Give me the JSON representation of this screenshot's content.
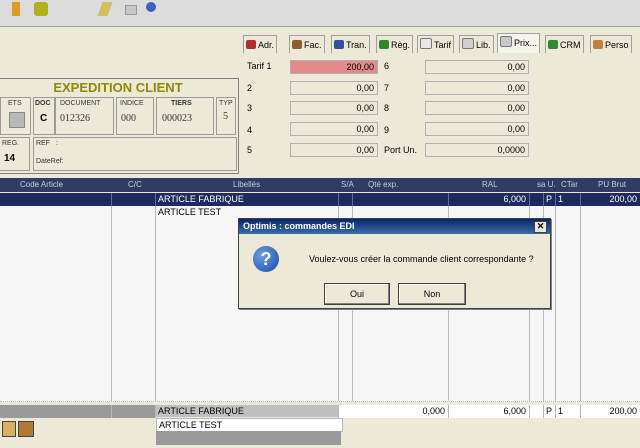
{
  "colors": {
    "tarif1_bg": "#e48a8a",
    "grid_head": "#313b66",
    "selected_row": "#1c2a5e",
    "title_olive": "#8b8b00"
  },
  "tabs": [
    {
      "label": "Adr.",
      "icon": "address-icon"
    },
    {
      "label": "Fac.",
      "icon": "invoice-icon"
    },
    {
      "label": "Tran.",
      "icon": "truck-icon"
    },
    {
      "label": "Règ.",
      "icon": "money-icon"
    },
    {
      "label": "Tarif",
      "icon": "tariff-icon"
    },
    {
      "label": "Lib.",
      "icon": "lib-icon"
    },
    {
      "label": "Prix...",
      "icon": "price-icon"
    },
    {
      "label": "CRM",
      "icon": "crm-icon"
    },
    {
      "label": "Perso",
      "icon": "person-icon"
    }
  ],
  "header": {
    "title": "EXPEDITION CLIENT",
    "ets_label": "ETS",
    "doc_label": "DOC",
    "doc_value": "C",
    "document_label": "DOCUMENT",
    "document_value": "012326",
    "indice_label": "INDICE",
    "indice_value": "000",
    "tiers_label": "TIERS",
    "tiers_value": "000023",
    "typ_label": "TYP",
    "typ_value": "5",
    "reg_label": "REG.",
    "reg_value": "14",
    "ref_label": "REF",
    "ref_value": ":",
    "dateref_label": "DateRef:"
  },
  "tarifs": {
    "t1_label": "Tarif 1",
    "t1_value": "200,00",
    "t2_label": "2",
    "t2_value": "0,00",
    "t3_label": "3",
    "t3_value": "0,00",
    "t4_label": "4",
    "t4_value": "0,00",
    "t5_label": "5",
    "t5_value": "0,00",
    "t6_label": "6",
    "t6_value": "0,00",
    "t7_label": "7",
    "t7_value": "0,00",
    "t8_label": "8",
    "t8_value": "0,00",
    "t9_label": "9",
    "t9_value": "0,00",
    "port_label": "Port Un.",
    "port_value": "0,0000"
  },
  "grid": {
    "headers": {
      "code": "Code Article",
      "cc": "C/C",
      "libelles": "Libellés",
      "sa": "S/A",
      "qte": "Qté exp.",
      "ral": "RAL",
      "sau": "sa U.",
      "ctar": "CTar",
      "pubrut": "PU Brut"
    },
    "row1": {
      "libelle": "ARTICLE FABRIQUE",
      "ral": "6,000",
      "u": "P",
      "ctar": "1",
      "pu": "200,00"
    },
    "row2": {
      "libelle": "ARTICLE TEST"
    },
    "total": {
      "libelle": "ARTICLE FABRIQUE",
      "qte": "0,000",
      "ral": "6,000",
      "u": "P",
      "ctar": "1",
      "pu": "200,00"
    },
    "total2": {
      "libelle": "ARTICLE TEST"
    }
  },
  "dialog": {
    "title": "Optimis : commandes EDI",
    "message": "Voulez-vous créer la commande client correspondante ?",
    "yes_label": "Oui",
    "no_label": "Non",
    "close_glyph": "✕"
  }
}
